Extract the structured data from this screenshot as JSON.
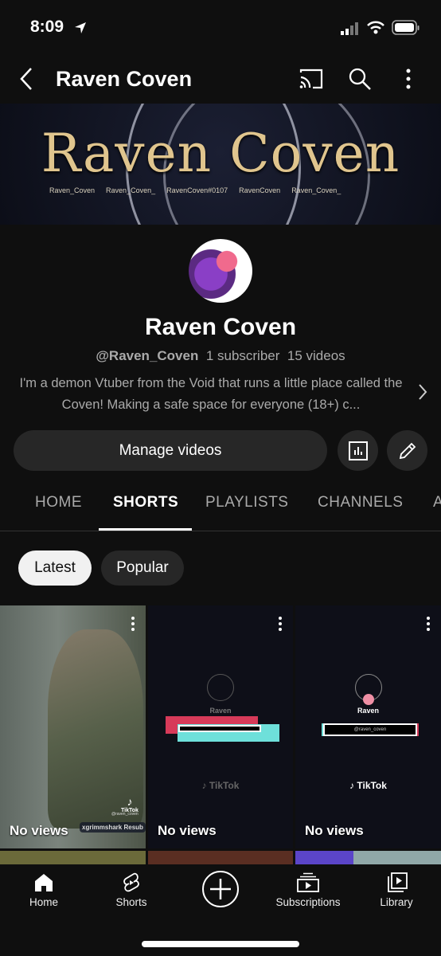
{
  "status_bar": {
    "time": "8:09"
  },
  "app_bar": {
    "title": "Raven Coven",
    "icons": [
      "back-icon",
      "cast-icon",
      "search-icon",
      "more-icon"
    ]
  },
  "banner": {
    "title": "Raven Coven",
    "socials": [
      "Raven_Coven",
      "Raven_Coven_",
      "RavenCoven#0107",
      "RavenCoven",
      "Raven_Coven_"
    ]
  },
  "channel": {
    "name": "Raven Coven",
    "handle": "@Raven_Coven",
    "subscribers": "1 subscriber",
    "videos": "15 videos",
    "description": "I'm a demon Vtuber from the Void that runs a little place called the Coven! Making a safe space for everyone (18+) c..."
  },
  "actions": {
    "manage_videos": "Manage videos"
  },
  "tabs": [
    {
      "label": "HOME"
    },
    {
      "label": "SHORTS",
      "active": true
    },
    {
      "label": "PLAYLISTS"
    },
    {
      "label": "CHANNELS"
    },
    {
      "label": "A"
    }
  ],
  "chips": [
    {
      "label": "Latest",
      "selected": true
    },
    {
      "label": "Popular"
    }
  ],
  "shorts": [
    {
      "views": "No views",
      "overlay": "xgrimmshark Resub",
      "badge": "TikTok",
      "handle": "@raven_coven"
    },
    {
      "views": "No views",
      "name": "Raven",
      "badge": "TikTok"
    },
    {
      "views": "No views",
      "name": "Raven",
      "search": "@raven_coven",
      "badge": "TikTok"
    }
  ],
  "bottom_nav": [
    {
      "label": "Home",
      "active": true
    },
    {
      "label": "Shorts"
    },
    {
      "label": ""
    },
    {
      "label": "Subscriptions"
    },
    {
      "label": "Library"
    }
  ],
  "colors": {
    "background": "#0f0f0f",
    "button": "#272727",
    "banner_gold": "#e0c58e"
  }
}
